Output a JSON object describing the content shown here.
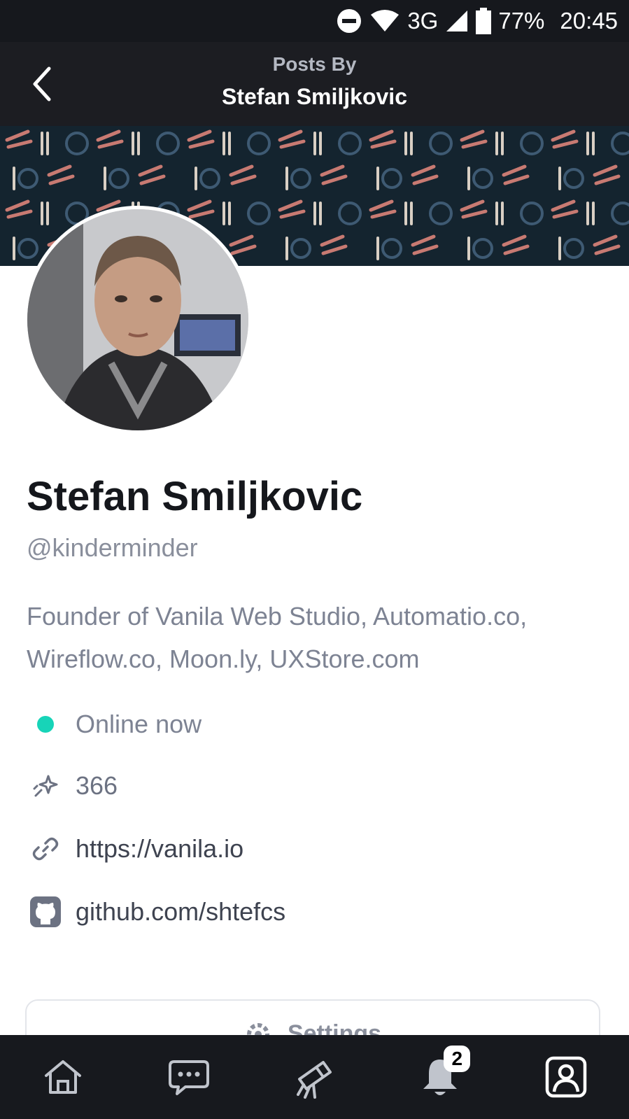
{
  "status_bar": {
    "network": "3G",
    "battery": "77%",
    "time": "20:45",
    "icons": [
      "do-not-disturb-icon",
      "wifi-icon",
      "signal-icon",
      "battery-icon"
    ]
  },
  "header": {
    "subtitle": "Posts By",
    "title": "Stefan Smiljkovic",
    "back_icon": "chevron-left-icon"
  },
  "profile": {
    "name": "Stefan Smiljkovic",
    "handle": "@kinderminder",
    "bio": "Founder of Vanila Web Studio, Automatio.co, Wireflow.co, Moon.ly, UXStore.com",
    "details": [
      {
        "icon": "online-dot",
        "text": "Online now"
      },
      {
        "icon": "sparkle-icon",
        "text": "366"
      },
      {
        "icon": "link-icon",
        "text": "https://vanila.io"
      },
      {
        "icon": "github-icon",
        "text": "github.com/shtefcs"
      }
    ]
  },
  "settings": {
    "label": "Settings",
    "icon": "gear-icon"
  },
  "bottom_nav": {
    "items": [
      {
        "icon": "home-icon"
      },
      {
        "icon": "chat-icon"
      },
      {
        "icon": "telescope-icon"
      },
      {
        "icon": "bell-icon",
        "badge": "2"
      },
      {
        "icon": "profile-icon"
      }
    ]
  },
  "colors": {
    "top_bar": "#1c1d22",
    "banner": "#14242f",
    "online": "#17d4b8",
    "text_dark": "#15171c",
    "text_muted": "#7d8393"
  }
}
